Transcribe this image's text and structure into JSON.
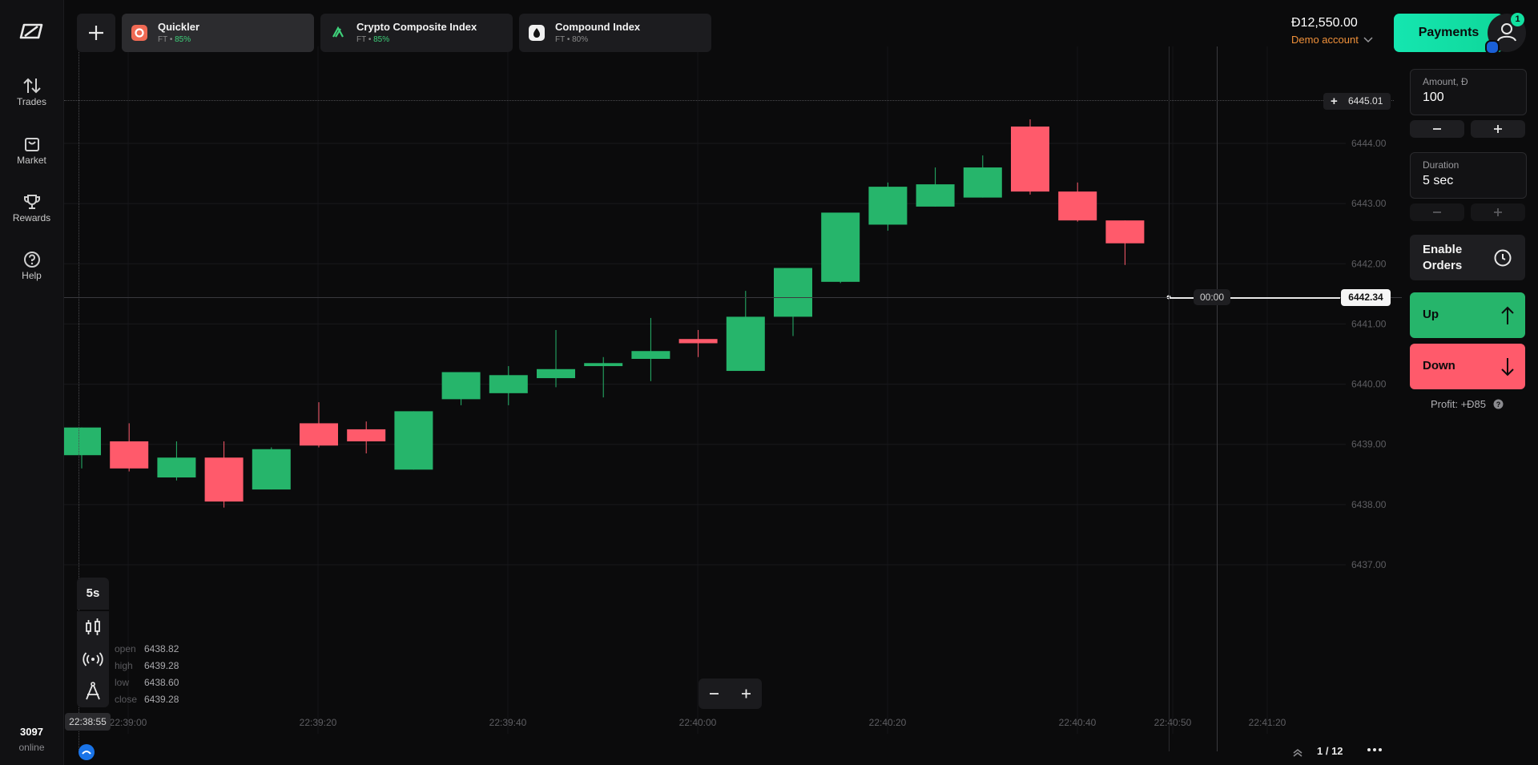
{
  "sidebar": {
    "items": [
      {
        "label": "Trades",
        "icon": "arrows-up-down-icon"
      },
      {
        "label": "Market",
        "icon": "shopping-bag-icon"
      },
      {
        "label": "Rewards",
        "icon": "trophy-icon"
      },
      {
        "label": "Help",
        "icon": "help-circle-icon"
      }
    ],
    "online_count": "3097",
    "online_label": "online"
  },
  "header": {
    "tabs": [
      {
        "name": "Quickler",
        "type": "FT",
        "payout": "85%",
        "active": true
      },
      {
        "name": "Crypto Composite Index",
        "type": "FT",
        "payout": "85%",
        "active": false
      },
      {
        "name": "Compound Index",
        "type": "FT",
        "payout": "80%",
        "active": false
      }
    ],
    "balance": "Đ12,550.00",
    "account_type": "Demo account",
    "payments_label": "Payments",
    "notification_count": "1"
  },
  "trade_panel": {
    "amount_label": "Amount, Đ",
    "amount_value": "100",
    "duration_label": "Duration",
    "duration_value": "5 sec",
    "enable_orders_label": "Enable Orders",
    "up_label": "Up",
    "down_label": "Down",
    "profit_label": "Profit: +Đ85"
  },
  "chart_controls": {
    "timeframe": "5s",
    "current_time": "22:38:55",
    "countdown": "00:00",
    "crosshair_price": "6445.01",
    "current_price": "6442.34",
    "pagination": "1 / 12"
  },
  "ohlc": {
    "open_label": "open",
    "open": "6438.82",
    "high_label": "high",
    "high": "6439.28",
    "low_label": "low",
    "low": "6438.60",
    "close_label": "close",
    "close": "6439.28"
  },
  "colors": {
    "up": "#26b56b",
    "down": "#ff5a6b",
    "accent": "#12e0a0",
    "demo": "#f0913a"
  },
  "chart_data": {
    "type": "candlestick",
    "y_ticks": [
      "6444.00",
      "6443.00",
      "6442.00",
      "6441.00",
      "6440.00",
      "6439.00",
      "6438.00",
      "6437.00"
    ],
    "x_ticks": [
      "22:39:00",
      "22:39:20",
      "22:39:40",
      "22:40:00",
      "22:40:20",
      "22:40:40",
      "22:40:50",
      "22:41:20"
    ],
    "ylim": [
      6436.6,
      6445.8
    ],
    "candles": [
      {
        "t": "22:38:55",
        "open": 6438.82,
        "high": 6439.28,
        "low": 6438.6,
        "close": 6439.28
      },
      {
        "t": "22:39:00",
        "open": 6439.05,
        "high": 6439.35,
        "low": 6438.55,
        "close": 6438.6
      },
      {
        "t": "22:39:05",
        "open": 6438.45,
        "high": 6439.05,
        "low": 6438.4,
        "close": 6438.78
      },
      {
        "t": "22:39:10",
        "open": 6438.78,
        "high": 6439.05,
        "low": 6437.95,
        "close": 6438.05
      },
      {
        "t": "22:39:15",
        "open": 6438.25,
        "high": 6438.95,
        "low": 6438.25,
        "close": 6438.92
      },
      {
        "t": "22:39:20",
        "open": 6439.35,
        "high": 6439.7,
        "low": 6438.95,
        "close": 6438.98
      },
      {
        "t": "22:39:25",
        "open": 6439.25,
        "high": 6439.38,
        "low": 6438.85,
        "close": 6439.05
      },
      {
        "t": "22:39:30",
        "open": 6438.58,
        "high": 6439.55,
        "low": 6438.58,
        "close": 6439.55
      },
      {
        "t": "22:39:35",
        "open": 6439.75,
        "high": 6440.2,
        "low": 6439.65,
        "close": 6440.2
      },
      {
        "t": "22:39:40",
        "open": 6439.85,
        "high": 6440.3,
        "low": 6439.65,
        "close": 6440.15
      },
      {
        "t": "22:39:45",
        "open": 6440.1,
        "high": 6440.9,
        "low": 6439.95,
        "close": 6440.25
      },
      {
        "t": "22:39:50",
        "open": 6440.3,
        "high": 6440.45,
        "low": 6439.78,
        "close": 6440.35
      },
      {
        "t": "22:39:55",
        "open": 6440.42,
        "high": 6441.1,
        "low": 6440.05,
        "close": 6440.55
      },
      {
        "t": "22:40:00",
        "open": 6440.75,
        "high": 6440.9,
        "low": 6440.45,
        "close": 6440.68
      },
      {
        "t": "22:40:05",
        "open": 6440.22,
        "high": 6441.55,
        "low": 6440.22,
        "close": 6441.12
      },
      {
        "t": "22:40:10",
        "open": 6441.12,
        "high": 6441.12,
        "low": 6440.8,
        "close": 6441.93
      },
      {
        "t": "22:40:15",
        "open": 6441.7,
        "high": 6442.65,
        "low": 6441.68,
        "close": 6442.85
      },
      {
        "t": "22:40:20",
        "open": 6442.65,
        "high": 6443.35,
        "low": 6442.55,
        "close": 6443.28
      },
      {
        "t": "22:40:25",
        "open": 6442.95,
        "high": 6443.6,
        "low": 6442.95,
        "close": 6443.32
      },
      {
        "t": "22:40:30",
        "open": 6443.1,
        "high": 6443.8,
        "low": 6443.1,
        "close": 6443.6
      },
      {
        "t": "22:40:35",
        "open": 6444.28,
        "high": 6444.4,
        "low": 6443.15,
        "close": 6443.2
      },
      {
        "t": "22:40:40",
        "open": 6443.2,
        "high": 6443.35,
        "low": 6442.7,
        "close": 6442.72
      },
      {
        "t": "22:40:45",
        "open": 6442.72,
        "high": 6442.72,
        "low": 6441.98,
        "close": 6442.34
      }
    ]
  }
}
